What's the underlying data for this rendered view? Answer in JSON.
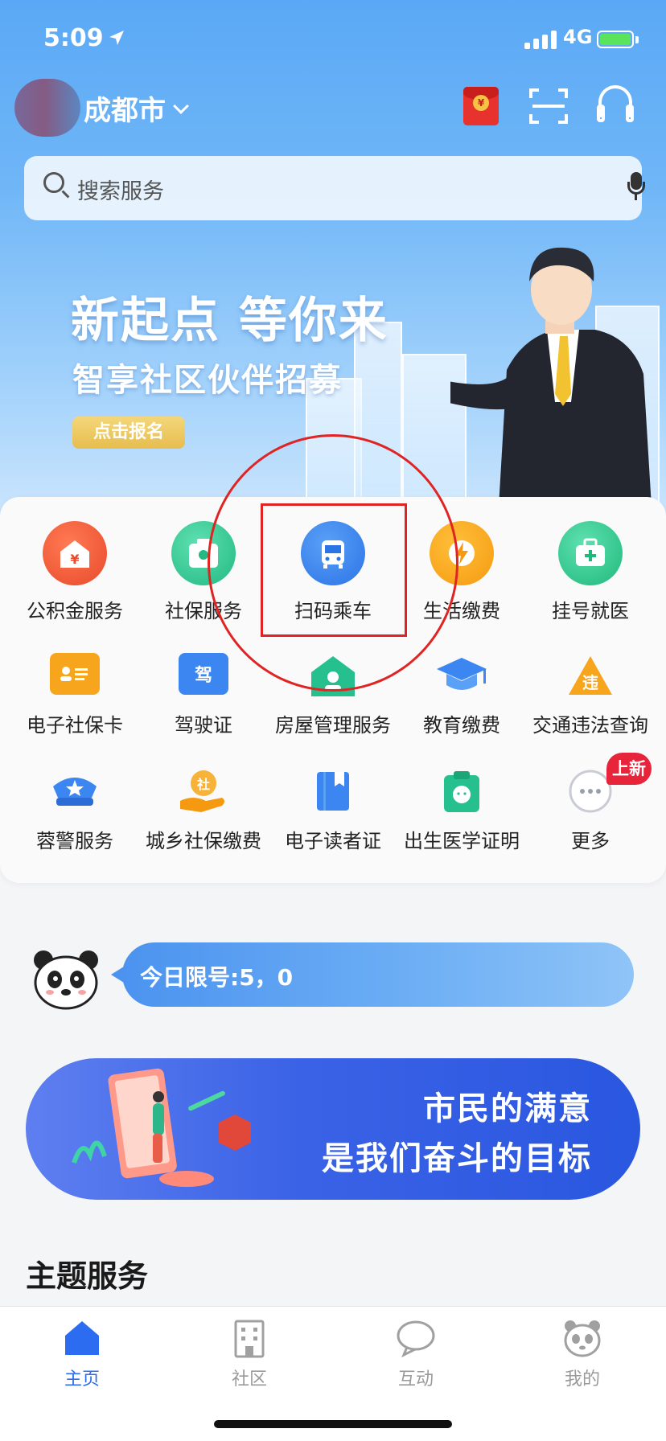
{
  "status_bar": {
    "time": "5:09",
    "network": "4G"
  },
  "header": {
    "city": "成都市"
  },
  "search": {
    "placeholder": "搜索服务"
  },
  "banner": {
    "title": "新起点 等你来",
    "subtitle": "智享社区伙伴招募",
    "button": "点击报名"
  },
  "services": {
    "row1": [
      "公积金服务",
      "社保服务",
      "扫码乘车",
      "生活缴费",
      "挂号就医"
    ],
    "row2": [
      "电子社保卡",
      "驾驶证",
      "房屋管理服务",
      "教育缴费",
      "交通违法查询"
    ],
    "row3": [
      "蓉警服务",
      "城乡社保缴费",
      "电子读者证",
      "出生医学证明",
      "更多"
    ],
    "new_badge": "上新"
  },
  "icon_glyphs": {
    "fund": "¥",
    "license": "驾",
    "violation": "违",
    "social": "社",
    "plus": "+"
  },
  "plate": {
    "text": "今日限号:5，0"
  },
  "slogan": {
    "line1": "市民的满意",
    "line2": "是我们奋斗的目标"
  },
  "section": {
    "title": "主题服务"
  },
  "tabbar": {
    "home": "主页",
    "community": "社区",
    "interact": "互动",
    "mine": "我的"
  },
  "colors": {
    "accent": "#2b6cf0",
    "highlight": "#e02424"
  }
}
